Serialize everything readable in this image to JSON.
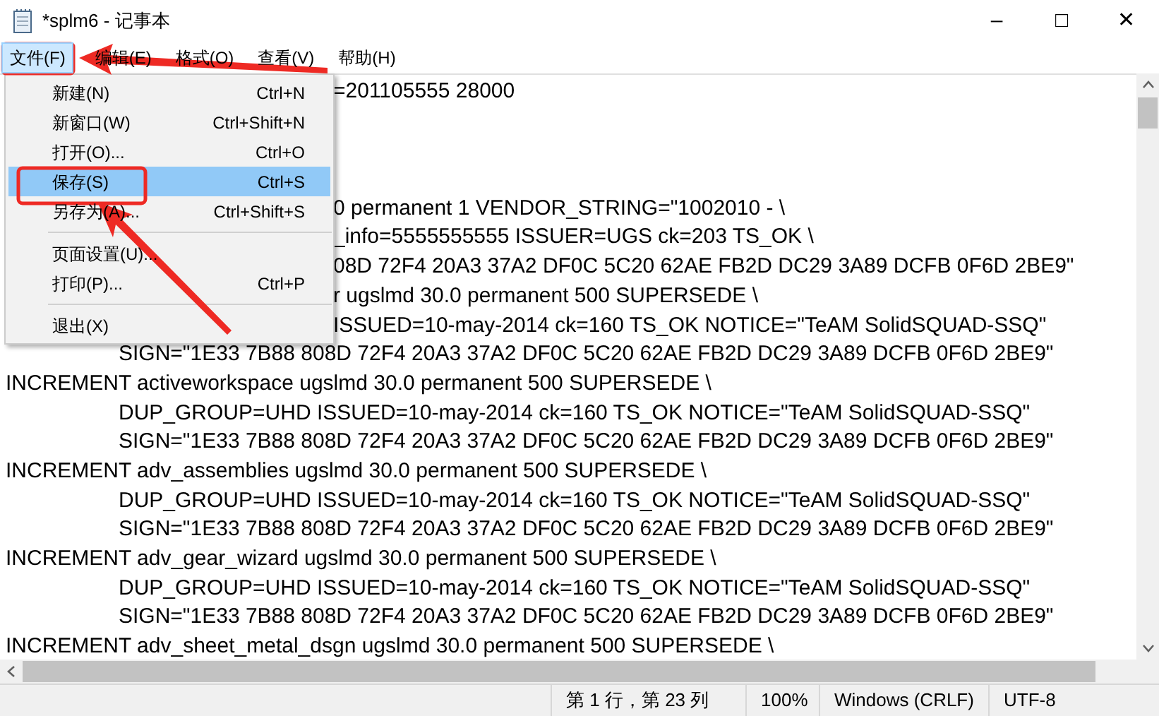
{
  "window": {
    "title": "*splm6 - 记事本",
    "controls": [
      "–",
      "□",
      "✕"
    ]
  },
  "menu_bar": [
    {
      "label": "文件(F)",
      "selected": true
    },
    {
      "label": "编辑(E)",
      "selected": false
    },
    {
      "label": "格式(O)",
      "selected": false
    },
    {
      "label": "查看(V)",
      "selected": false
    },
    {
      "label": "帮助(H)",
      "selected": false
    }
  ],
  "file_menu": [
    {
      "kind": "item",
      "label": "新建(N)",
      "shortcut": "Ctrl+N",
      "selected": false
    },
    {
      "kind": "item",
      "label": "新窗口(W)",
      "shortcut": "Ctrl+Shift+N",
      "selected": false
    },
    {
      "kind": "item",
      "label": "打开(O)...",
      "shortcut": "Ctrl+O",
      "selected": false
    },
    {
      "kind": "item",
      "label": "保存(S)",
      "shortcut": "Ctrl+S",
      "selected": true
    },
    {
      "kind": "item",
      "label": "另存为(A)...",
      "shortcut": "Ctrl+Shift+S",
      "selected": false
    },
    {
      "kind": "separator"
    },
    {
      "kind": "item",
      "label": "页面设置(U)...",
      "selected": false
    },
    {
      "kind": "item",
      "label": "打印(P)...",
      "shortcut": "Ctrl+P",
      "selected": false
    },
    {
      "kind": "separator"
    },
    {
      "kind": "item",
      "label": "退出(X)",
      "selected": false
    }
  ],
  "editor_lines": [
    {
      "kind": "partial",
      "text": "=201105555 28000"
    },
    {
      "kind": "blank"
    },
    {
      "kind": "blank"
    },
    {
      "kind": "blank"
    },
    {
      "kind": "partial",
      "text": "0 permanent 1 VENDOR_STRING=\"1002010 - \\"
    },
    {
      "kind": "partial",
      "text": "_info=5555555555 ISSUER=UGS ck=203 TS_OK \\"
    },
    {
      "kind": "partial",
      "text": "08D 72F4 20A3 37A2 DF0C 5C20 62AE FB2D DC29 3A89 DCFB 0F6D 2BE9\""
    },
    {
      "kind": "partial",
      "text": "r ugslmd 30.0 permanent 500 SUPERSEDE \\"
    },
    {
      "kind": "partial",
      "text": "ISSUED=10-may-2014 ck=160 TS_OK NOTICE=\"TeAM SolidSQUAD-SSQ\""
    },
    {
      "kind": "indented",
      "text": "SIGN=\"1E33 7B88 808D 72F4 20A3 37A2 DF0C 5C20 62AE FB2D DC29 3A89 DCFB 0F6D 2BE9\""
    },
    {
      "kind": "full",
      "text": "INCREMENT activeworkspace ugslmd 30.0 permanent 500 SUPERSEDE \\"
    },
    {
      "kind": "indented",
      "text": "DUP_GROUP=UHD ISSUED=10-may-2014 ck=160 TS_OK NOTICE=\"TeAM SolidSQUAD-SSQ\""
    },
    {
      "kind": "indented",
      "text": "SIGN=\"1E33 7B88 808D 72F4 20A3 37A2 DF0C 5C20 62AE FB2D DC29 3A89 DCFB 0F6D 2BE9\""
    },
    {
      "kind": "full",
      "text": "INCREMENT adv_assemblies ugslmd 30.0 permanent 500 SUPERSEDE \\"
    },
    {
      "kind": "indented",
      "text": "DUP_GROUP=UHD ISSUED=10-may-2014 ck=160 TS_OK NOTICE=\"TeAM SolidSQUAD-SSQ\""
    },
    {
      "kind": "indented",
      "text": "SIGN=\"1E33 7B88 808D 72F4 20A3 37A2 DF0C 5C20 62AE FB2D DC29 3A89 DCFB 0F6D 2BE9\""
    },
    {
      "kind": "full",
      "text": "INCREMENT adv_gear_wizard ugslmd 30.0 permanent 500 SUPERSEDE \\"
    },
    {
      "kind": "indented",
      "text": "DUP_GROUP=UHD ISSUED=10-may-2014 ck=160 TS_OK NOTICE=\"TeAM SolidSQUAD-SSQ\""
    },
    {
      "kind": "indented",
      "text": "SIGN=\"1E33 7B88 808D 72F4 20A3 37A2 DF0C 5C20 62AE FB2D DC29 3A89 DCFB 0F6D 2BE9\""
    },
    {
      "kind": "full",
      "text": "INCREMENT adv_sheet_metal_dsgn ugslmd 30.0 permanent 500 SUPERSEDE \\"
    }
  ],
  "status_bar": [
    "第 1 行，第 23 列",
    "100%",
    "Windows (CRLF)",
    "UTF-8"
  ]
}
